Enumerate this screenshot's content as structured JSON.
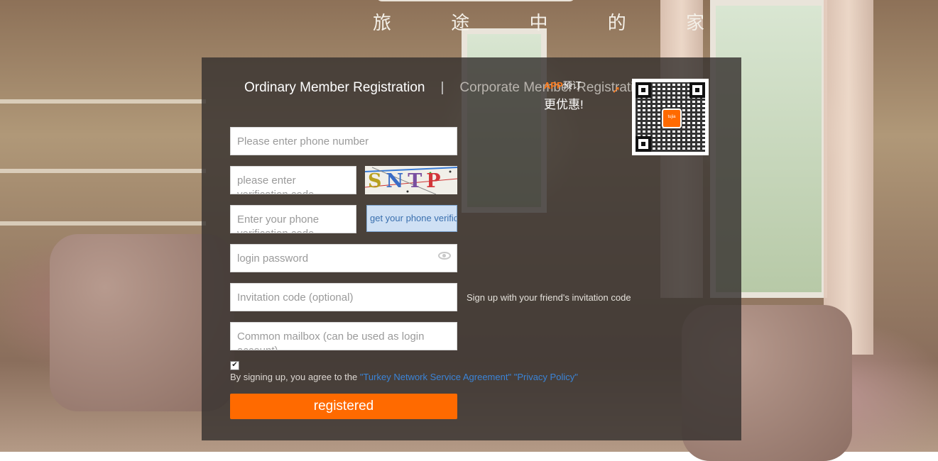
{
  "logo": {
    "slogan": "旅 途 中 的 家"
  },
  "tabs": {
    "ordinary": "Ordinary Member Registration",
    "separator": "|",
    "corporate": "Corporate Member Registration"
  },
  "form": {
    "phone_placeholder": "Please enter phone number",
    "captcha_placeholder": "please enter verification code",
    "captcha_text": "SNTP",
    "sms_code_placeholder": "Enter your phone verification code",
    "sms_button": "get your phone verification code",
    "password_placeholder": "login password",
    "invitation_placeholder": "Invitation code (optional)",
    "invitation_hint": "Sign up with your friend's invitation code",
    "email_placeholder": "Common mailbox (can be used as login account)",
    "agree_checked": true,
    "agree_prefix": "By signing up, you agree to the",
    "agreement_link": "\"Turkey Network Service Agreement\"",
    "privacy_link": "\"Privacy Policy\"",
    "submit": "registered"
  },
  "app_promo": {
    "app_tag": "APP",
    "book": "预订",
    "discount": "更优惠!",
    "qr_logo": "tujia"
  },
  "colors": {
    "accent": "#ff6a00",
    "link": "#3b84d6"
  }
}
